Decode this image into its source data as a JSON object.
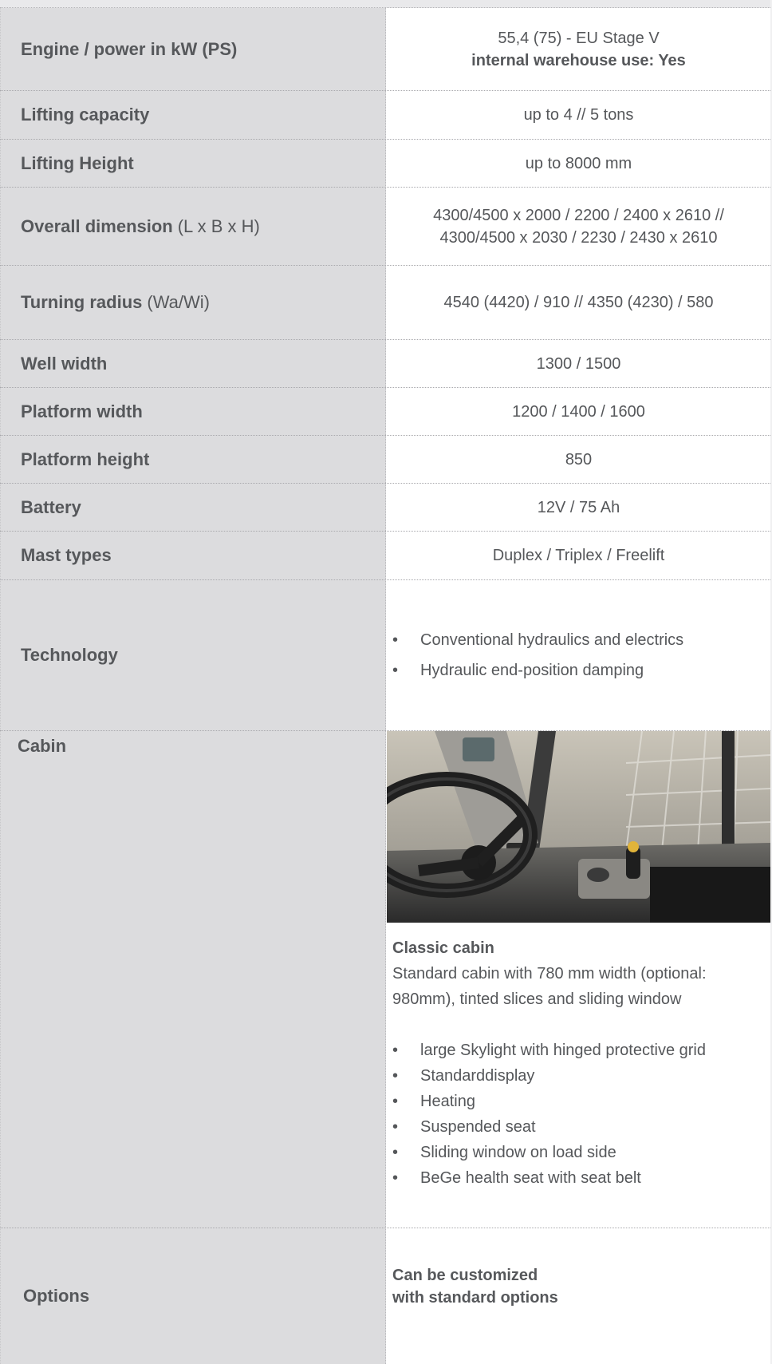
{
  "rows": {
    "engine": {
      "label": "Engine / power in kW (PS)",
      "value_line1": "55,4 (75) - EU Stage V",
      "value_line2": "internal warehouse use: Yes"
    },
    "lifting_capacity": {
      "label": "Lifting capacity",
      "value": "up to 4 // 5 tons"
    },
    "lifting_height": {
      "label": "Lifting Height",
      "value": "up to 8000 mm"
    },
    "overall_dimension": {
      "label": "Overall dimension",
      "label_suffix": "(L x B x H)",
      "value_line1": "4300/4500 x 2000 / 2200 / 2400 x 2610 //",
      "value_line2": "4300/4500 x 2030 / 2230 / 2430 x 2610"
    },
    "turning_radius": {
      "label": "Turning radius",
      "label_suffix": "(Wa/Wi)",
      "value": "4540 (4420) / 910 // 4350 (4230) / 580"
    },
    "well_width": {
      "label": "Well width",
      "value": "1300 / 1500"
    },
    "platform_width": {
      "label": "Platform width",
      "value": "1200 / 1400 / 1600"
    },
    "platform_height": {
      "label": "Platform height",
      "value": "850"
    },
    "battery": {
      "label": "Battery",
      "value": "12V / 75 Ah"
    },
    "mast_types": {
      "label": "Mast types",
      "value": "Duplex / Triplex / Freelift"
    },
    "technology": {
      "label": "Technology",
      "items": [
        "Conventional hydraulics and electrics",
        "Hydraulic  end-position damping"
      ]
    },
    "cabin": {
      "label": "Cabin",
      "title": "Classic cabin",
      "description_line1": "Standard cabin with 780 mm width (optional:",
      "description_line2": "980mm), tinted slices and sliding window",
      "items": [
        "large Skylight with hinged protective grid",
        "Standarddisplay",
        "Heating",
        "Suspended seat",
        "Sliding window on load side",
        "BeGe health seat with seat belt"
      ]
    },
    "options": {
      "label": "Options",
      "value_line1": "Can be customized",
      "value_line2": "with standard options"
    }
  }
}
